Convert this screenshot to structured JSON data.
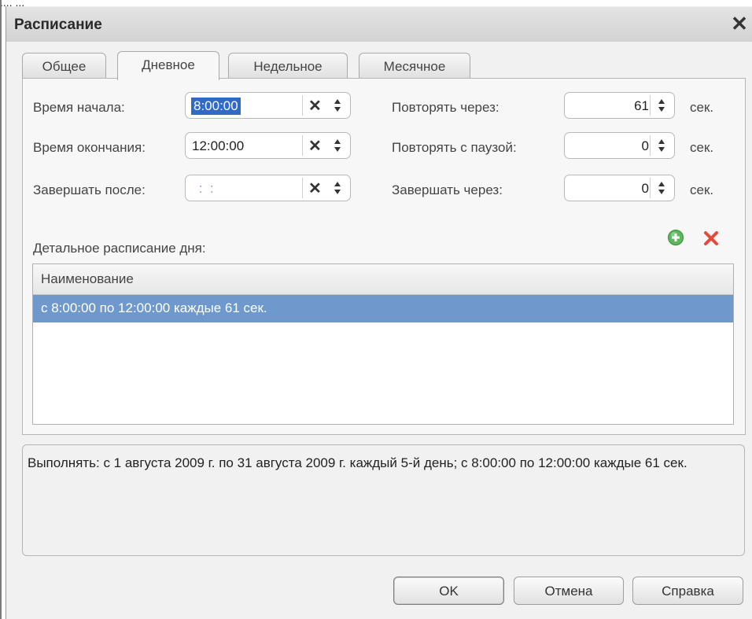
{
  "window": {
    "top_fragment": "..., ,,,",
    "title": "Расписание",
    "close_glyph": "✕"
  },
  "tabs": [
    {
      "label": "Общее",
      "active": false
    },
    {
      "label": "Дневное",
      "active": true
    },
    {
      "label": "Недельное",
      "active": false
    },
    {
      "label": "Месячное",
      "active": false
    }
  ],
  "form": {
    "start_time": {
      "label": "Время начала:",
      "value": "8:00:00"
    },
    "end_time": {
      "label": "Время окончания:",
      "value": "12:00:00"
    },
    "finish_after": {
      "label": "Завершать после:",
      "value": " :  :"
    },
    "repeat_every": {
      "label": "Повторять через:",
      "value": "61",
      "unit": "сек."
    },
    "repeat_pause": {
      "label": "Повторять с паузой:",
      "value": "0",
      "unit": "сек."
    },
    "finish_in": {
      "label": "Завершать через:",
      "value": "0",
      "unit": "сек."
    },
    "clear_glyph": "✕"
  },
  "detail": {
    "label": "Детальное расписание дня:",
    "add_icon": "plus-circle-icon",
    "delete_icon": "red-x-icon",
    "column_header": "Наименование",
    "rows": [
      "с 8:00:00 по 12:00:00 каждые 61 сек."
    ]
  },
  "summary": "Выполнять: с 1 августа 2009 г. по 31 августа 2009 г. каждый 5-й день; с 8:00:00 по 12:00:00 каждые 61 сек.",
  "buttons": {
    "ok": "OK",
    "cancel": "Отмена",
    "help": "Справка"
  },
  "colors": {
    "selection": "#6f99cc",
    "accent_green": "#4caf50",
    "accent_red": "#e53935"
  }
}
